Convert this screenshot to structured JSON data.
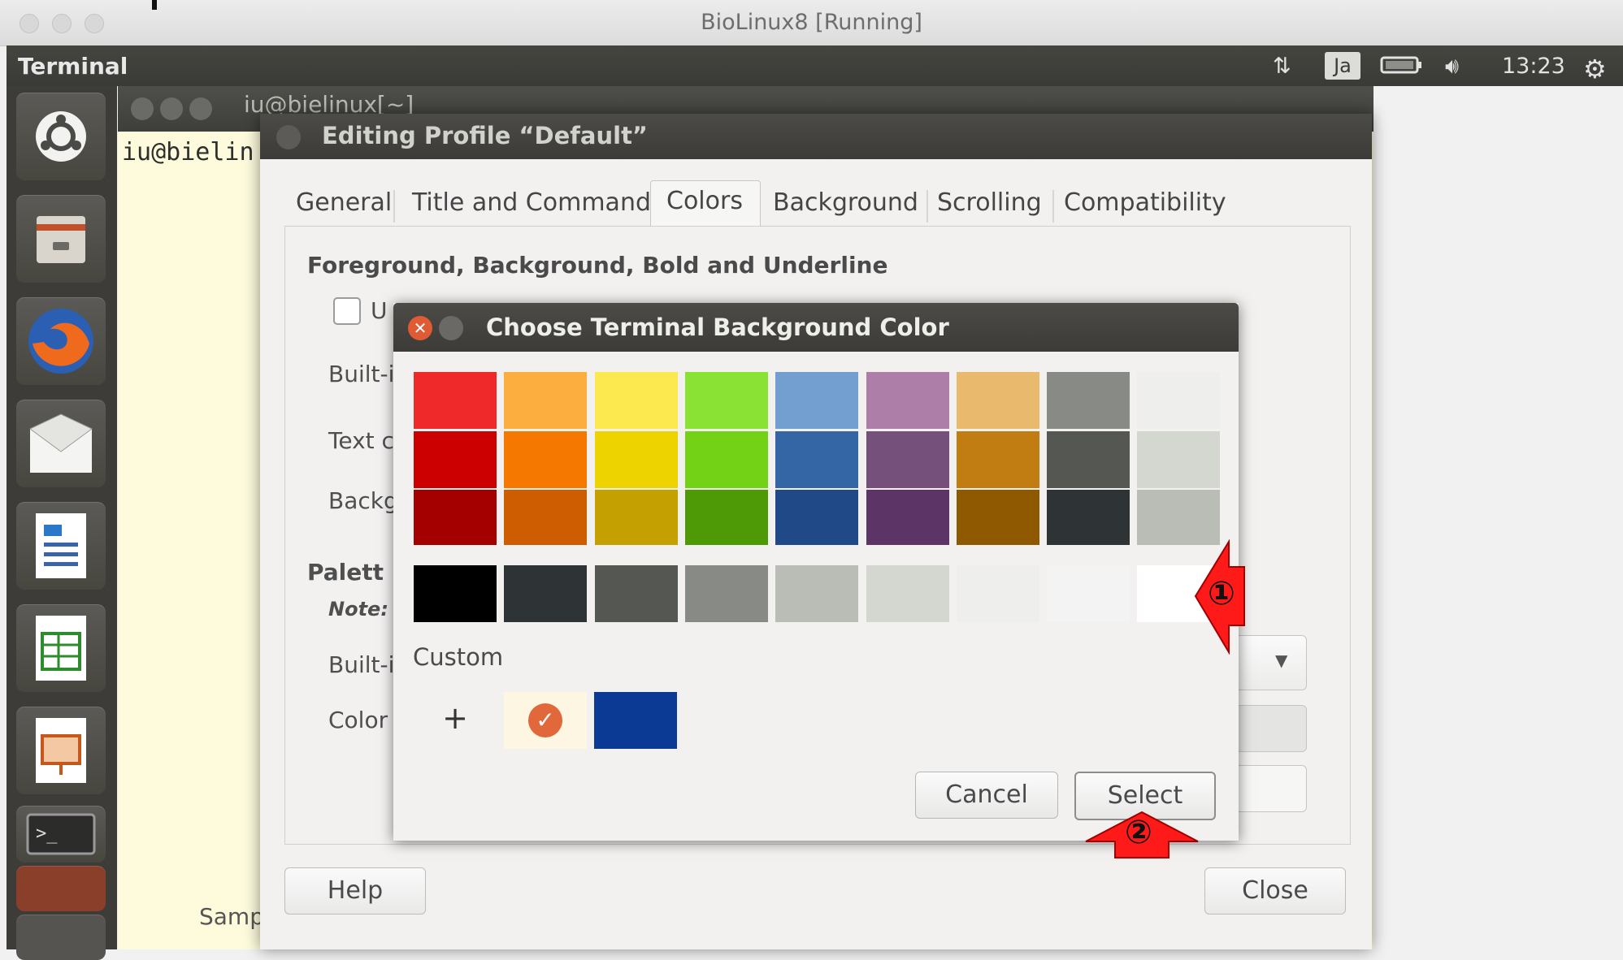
{
  "vm_window": {
    "title": "BioLinux8 [Running]"
  },
  "topbar": {
    "app_name": "Terminal",
    "input_method": "Ja",
    "clock": "13:23"
  },
  "terminal": {
    "title": "iu@bielinux[~]",
    "prompt": "iu@bielin",
    "bottom_text": "Samp"
  },
  "profile_dialog": {
    "title": "Editing Profile “Default”",
    "tabs": [
      "General",
      "Title and Command",
      "Colors",
      "Background",
      "Scrolling",
      "Compatibility"
    ],
    "active_tab": "Colors",
    "section_fg": "Foreground, Background, Bold and Underline",
    "checkbox_label": "U",
    "builtin_label_1": "Built-i",
    "text_label": "Text c",
    "back_label": "Backg",
    "palette_label": "Palett",
    "note_label": "Note: ",
    "builtin_label_2": "Built-i",
    "color_label": "Color",
    "help_button": "Help",
    "close_button": "Close"
  },
  "color_chooser": {
    "title": "Choose Terminal Background Color",
    "custom_label": "Custom",
    "add_custom": "+",
    "cancel_button": "Cancel",
    "select_button": "Select",
    "palette_columns": [
      [
        "#ef2929",
        "#cc0000",
        "#a40000"
      ],
      [
        "#fcaf3e",
        "#f57900",
        "#ce5c00"
      ],
      [
        "#fce94f",
        "#edd400",
        "#c4a000"
      ],
      [
        "#8ae234",
        "#73d216",
        "#4e9a06"
      ],
      [
        "#729fcf",
        "#3465a4",
        "#204a87"
      ],
      [
        "#ad7fa8",
        "#75507b",
        "#5c3566"
      ],
      [
        "#e9b96e",
        "#c17d11",
        "#8f5902"
      ],
      [
        "#888a85",
        "#555753",
        "#2e3436"
      ],
      [
        "#eeeeec",
        "#d3d7cf",
        "#babdb6"
      ]
    ],
    "gray_row": [
      "#000000",
      "#2e3436",
      "#555753",
      "#888a85",
      "#babdb6",
      "#d3d7cf",
      "#eeeeec",
      "#f3f3f3",
      "#ffffff"
    ],
    "custom_colors": [
      "#fdf6e3",
      "#0b3a94"
    ],
    "selected_custom_index": 0
  },
  "annotations": {
    "marker_1": "①",
    "marker_2": "②"
  }
}
